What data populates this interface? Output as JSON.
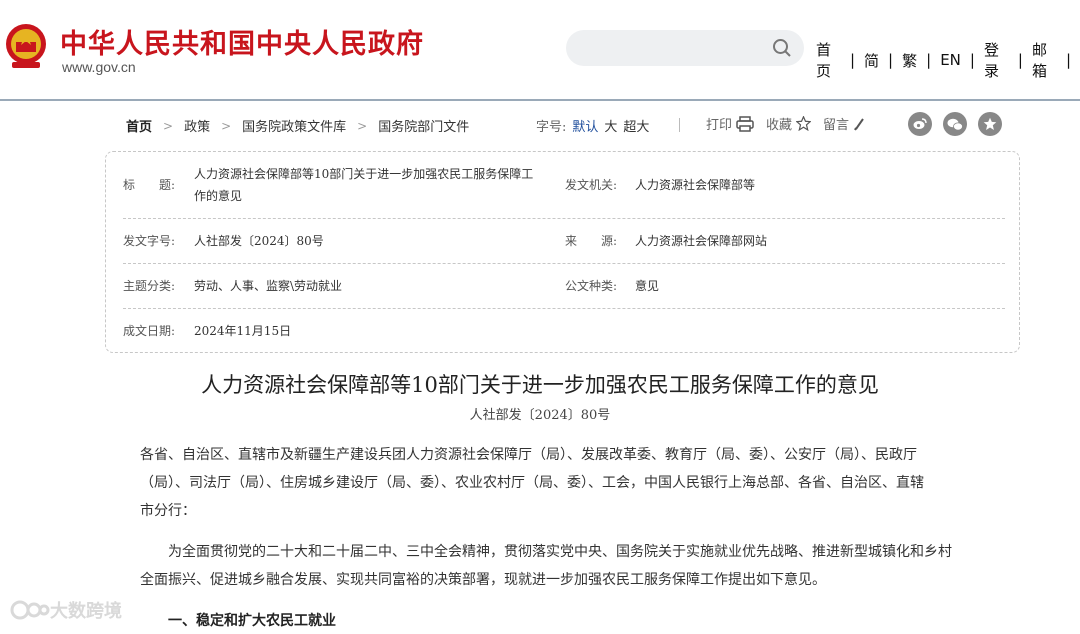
{
  "header": {
    "site_title": "中华人民共和国中央人民政府",
    "site_url": "www.gov.cn",
    "search_placeholder": "",
    "nav": [
      "首页",
      "简",
      "繁",
      "EN",
      "登录",
      "邮箱"
    ],
    "nav_separator": "|",
    "colors": {
      "brand_red": "#c8151d",
      "accent_blue": "#1f4e9c"
    }
  },
  "breadcrumb": {
    "items": [
      "首页",
      "政策",
      "国务院政策文件库",
      "国务院部门文件"
    ],
    "arrow": ">"
  },
  "toolbar": {
    "font_label": "字号:",
    "font_options": [
      "默认",
      "大",
      "超大"
    ],
    "print": "打印",
    "favorite": "收藏",
    "comment": "留言",
    "share_icons": [
      "weibo-icon",
      "wechat-icon",
      "qzone-icon"
    ]
  },
  "info": {
    "title_label": "标　　题:",
    "title_value_line1": "人力资源社会保障部等10部门关于进一步加强农民工服务保障工",
    "title_value_line2": "作的意见",
    "issuer_label": "发文机关:",
    "issuer_value": "人力资源社会保障部等",
    "docno_label": "发文字号:",
    "docno_value": "人社部发〔2024〕80号",
    "source_label": "来　　源:",
    "source_value": "人力资源社会保障部网站",
    "topic_label": "主题分类:",
    "topic_value": "劳动、人事、监察\\劳动就业",
    "type_label": "公文种类:",
    "type_value": "意见",
    "date_label": "成文日期:",
    "date_value": "2024年11月15日"
  },
  "article": {
    "title": "人力资源社会保障部等10部门关于进一步加强农民工服务保障工作的意见",
    "doc_no": "人社部发〔2024〕80号",
    "addressee_line1": "各省、自治区、直辖市及新疆生产建设兵团人力资源社会保障厅（局）、发展改革委、教育厅（局、委）、公安厅（局）、民政厅",
    "addressee_line2": "（局）、司法厅（局）、住房城乡建设厅（局、委）、农业农村厅（局、委）、工会，中国人民银行上海总部、各省、自治区、直辖",
    "addressee_line3": "市分行：",
    "body_line1": "为全面贯彻党的二十大和二十届二中、三中全会精神，贯彻落实党中央、国务院关于实施就业优先战略、推进新型城镇化和乡村",
    "body_line2": "全面振兴、促进城乡融合发展、实现共同富裕的决策部署，现就进一步加强农民工服务保障工作提出如下意见。",
    "section1": "一、稳定和扩大农民工就业"
  },
  "watermark": {
    "text": "大数跨境"
  }
}
